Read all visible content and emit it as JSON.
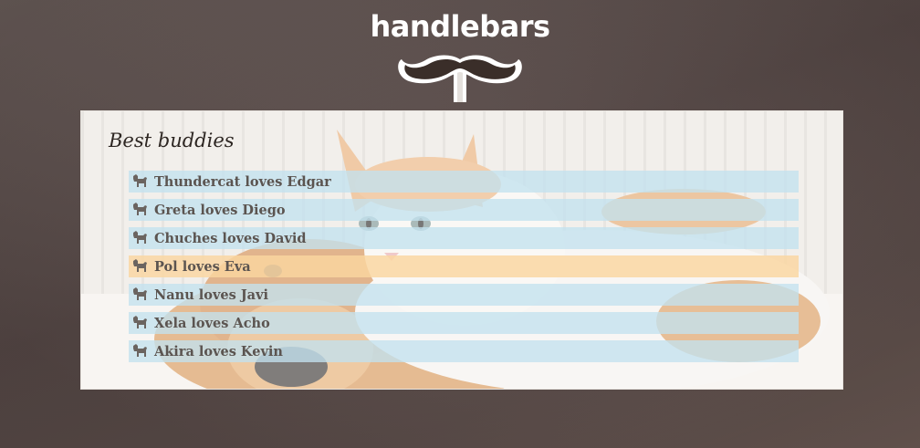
{
  "header": {
    "brand": "handlebars",
    "logo_icon": "mustache-icon"
  },
  "card": {
    "title": "Best buddies",
    "items": [
      {
        "label": "Thundercat loves Edgar",
        "icon": "dog-icon",
        "highlighted": false
      },
      {
        "label": "Greta loves Diego",
        "icon": "dog-icon",
        "highlighted": false
      },
      {
        "label": "Chuches loves David",
        "icon": "dog-icon",
        "highlighted": false
      },
      {
        "label": "Pol loves Eva",
        "icon": "dog-icon",
        "highlighted": true
      },
      {
        "label": "Nanu loves Javi",
        "icon": "dog-icon",
        "highlighted": false
      },
      {
        "label": "Xela loves Acho",
        "icon": "dog-icon",
        "highlighted": false
      },
      {
        "label": "Akira loves Kevin",
        "icon": "dog-icon",
        "highlighted": false
      }
    ]
  },
  "colors": {
    "row": "#c3e2ee",
    "row_highlight": "#fad6a0",
    "text": "#5b5450",
    "background": "#574947"
  }
}
